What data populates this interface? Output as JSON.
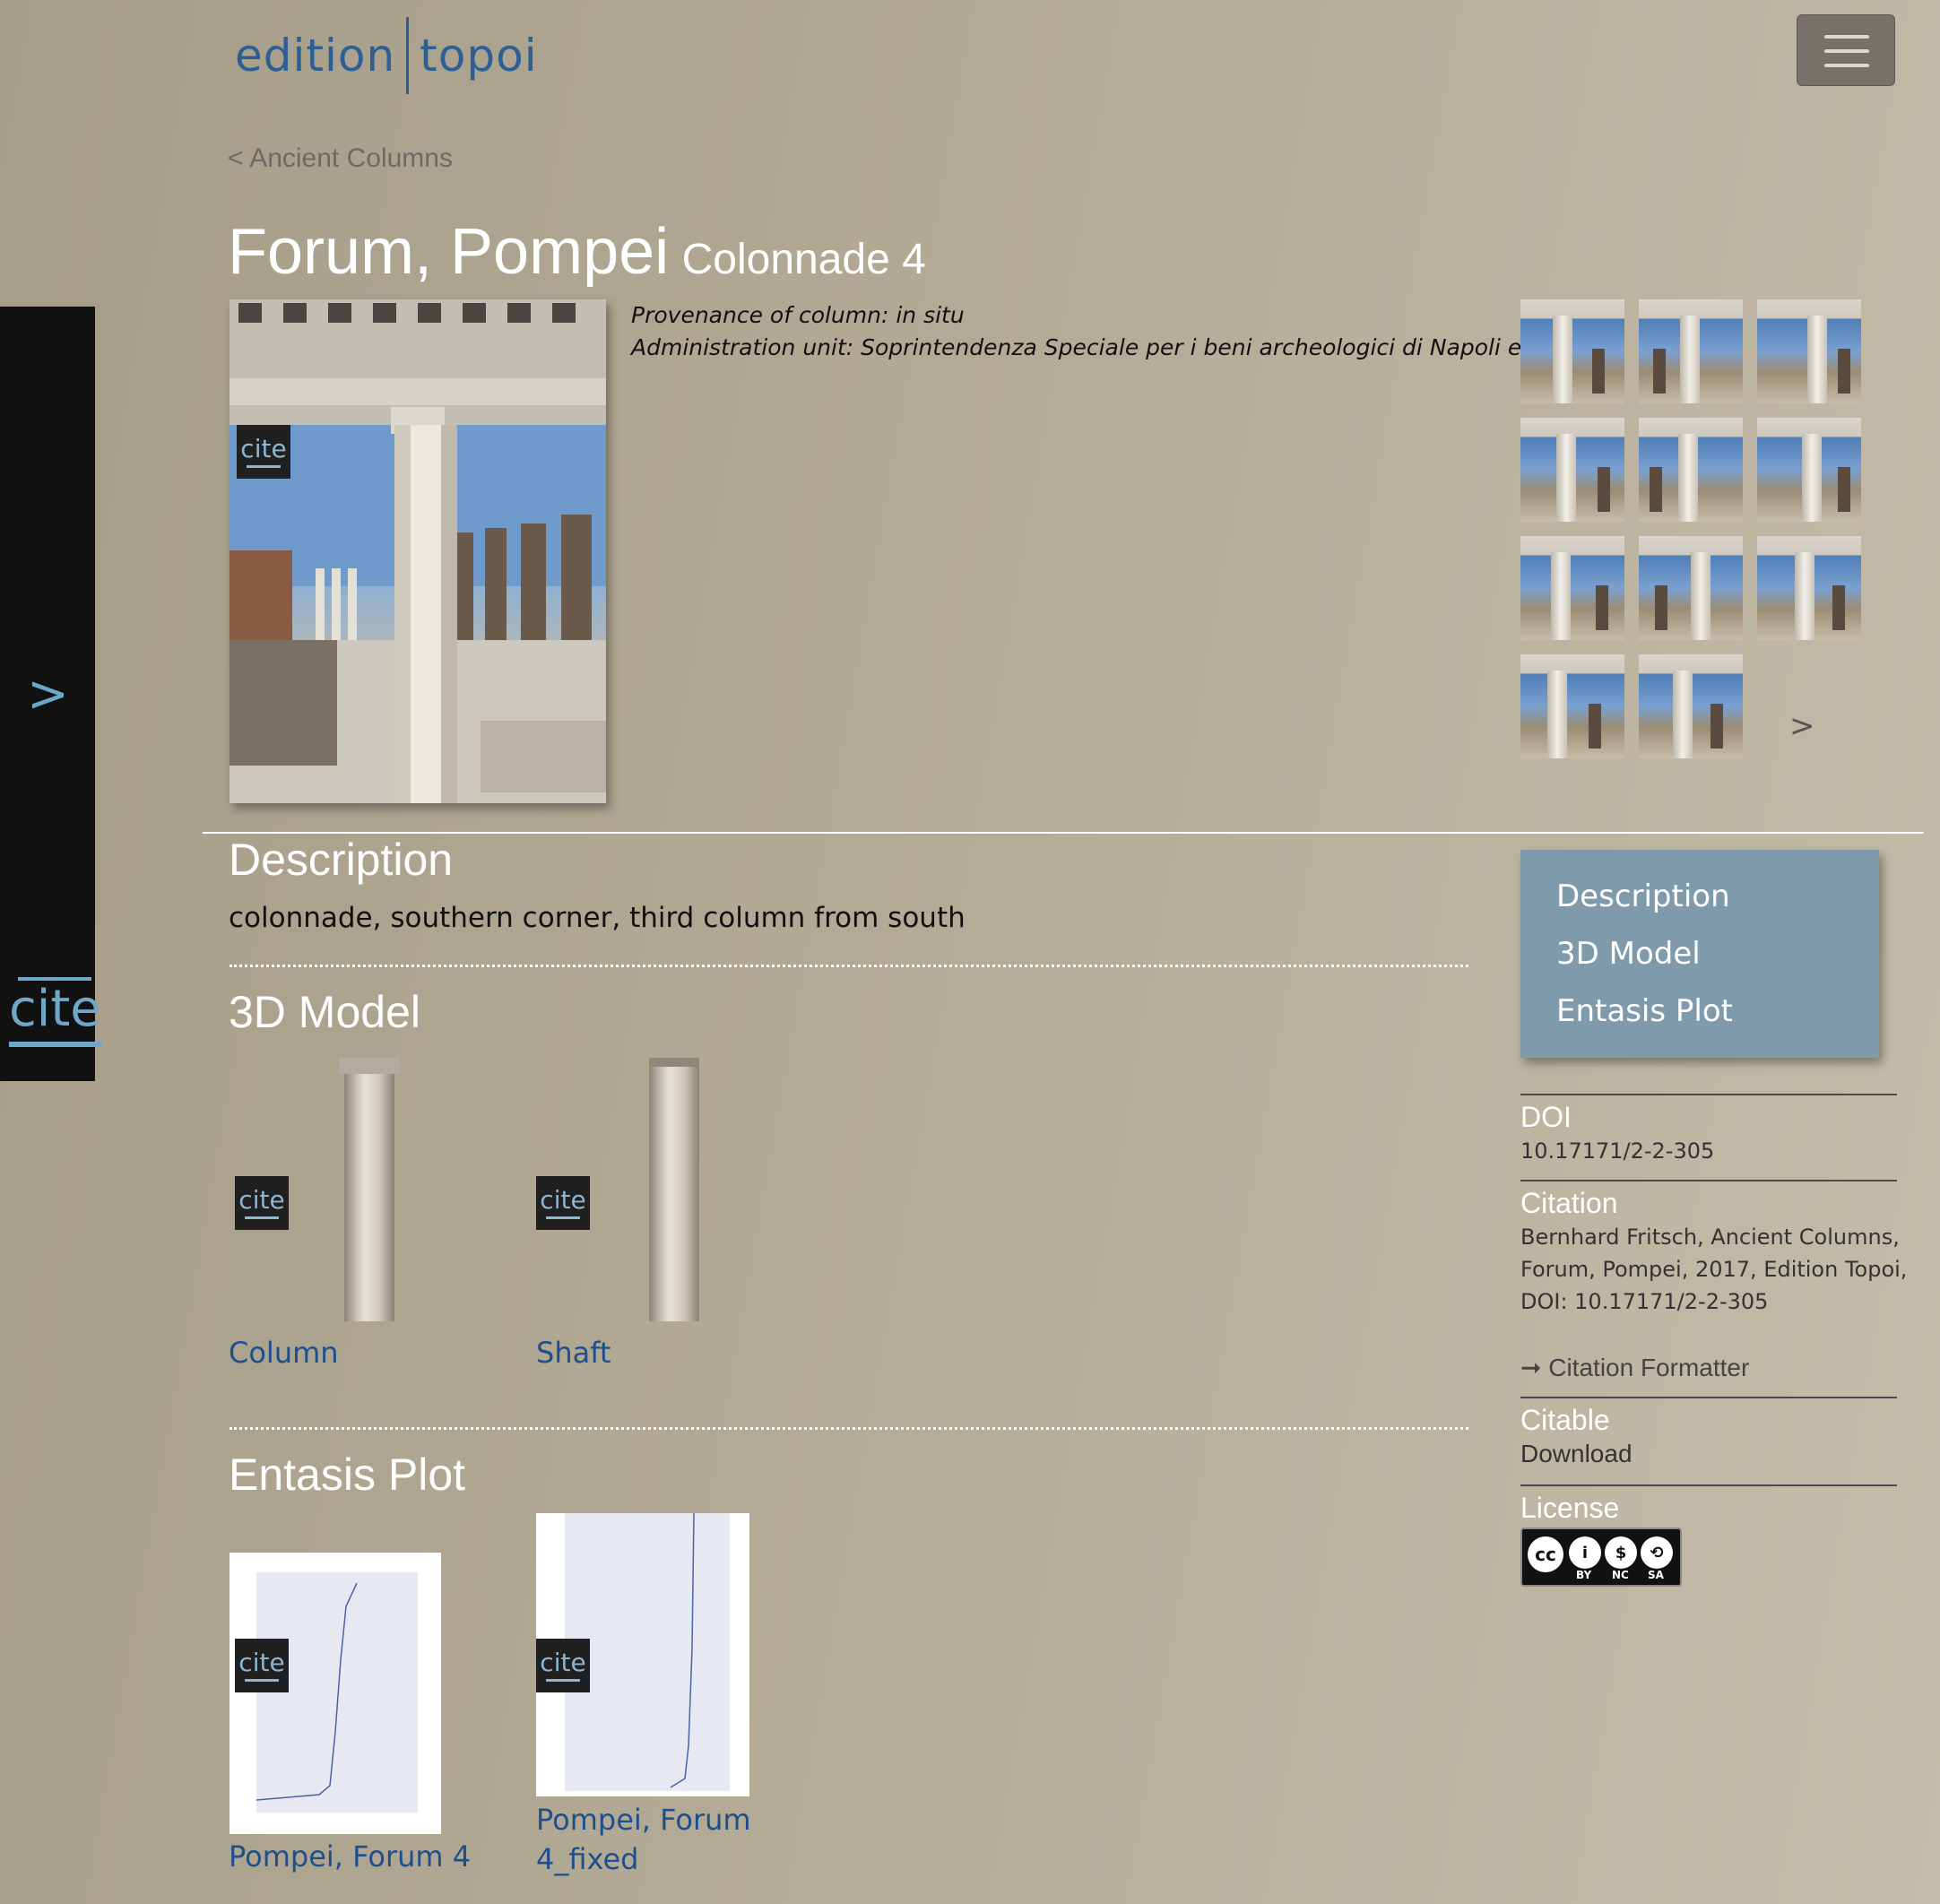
{
  "header": {
    "logo_left": "edition",
    "logo_right": "topoi"
  },
  "breadcrumb": "< Ancient Columns",
  "title": {
    "main": "Forum, Pompei",
    "sub": "Colonnade 4"
  },
  "sidebar": {
    "expand_glyph": ">",
    "cite_label": "cite"
  },
  "provenance": {
    "line1": "Provenance of column: in situ",
    "line2": "Administration unit: Soprintendenza Speciale per i beni archeologici di Napoli e Pompei"
  },
  "gallery": {
    "next_glyph": ">"
  },
  "cite_badge": "cite",
  "sections": {
    "description": {
      "heading": "Description",
      "text": "colonnade, southern corner, third column from south"
    },
    "model": {
      "heading": "3D Model",
      "items": [
        {
          "label": "Column"
        },
        {
          "label": "Shaft"
        }
      ]
    },
    "entasis": {
      "heading": "Entasis Plot",
      "items": [
        {
          "label": "Pompei, Forum 4"
        },
        {
          "label_line1": "Pompei, Forum",
          "label_line2": "4_fixed"
        }
      ]
    }
  },
  "toc": {
    "items": [
      "Description",
      "3D Model",
      "Entasis Plot"
    ]
  },
  "meta": {
    "doi_label": "DOI",
    "doi_value": "10.17171/2-2-305",
    "citation_label": "Citation",
    "citation_lines": [
      "Bernhard Fritsch, Ancient Columns,",
      "Forum, Pompei, 2017, Edition Topoi,",
      "DOI: 10.17171/2-2-305"
    ],
    "citation_formatter": "➞ Citation Formatter",
    "citable_label": "Citable",
    "download": "Download",
    "license_label": "License",
    "license_badge": {
      "cc": "cc",
      "by": "BY",
      "nc": "NC",
      "sa": "SA"
    }
  }
}
